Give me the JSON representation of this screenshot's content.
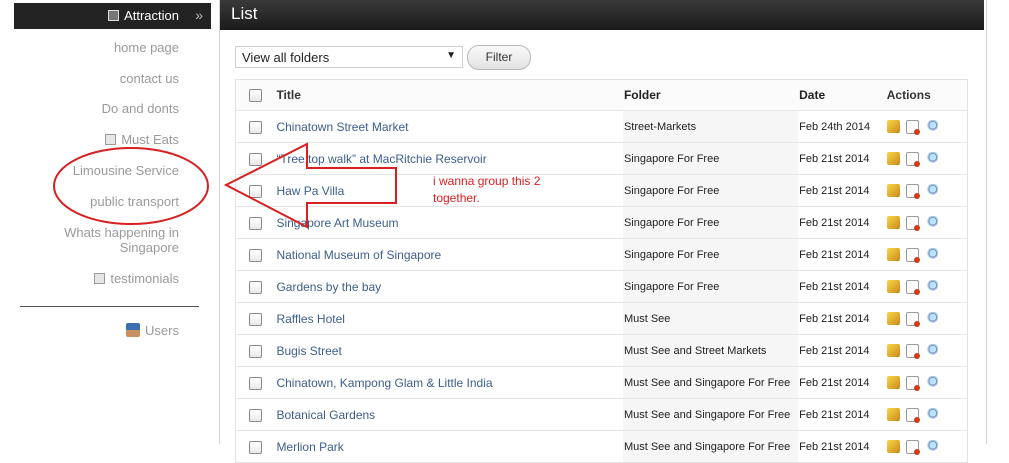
{
  "sidebar": {
    "active": {
      "label": "Attraction",
      "chevron": "»"
    },
    "items": [
      {
        "label": "home page",
        "has_icon": false
      },
      {
        "label": "contact us",
        "has_icon": false
      },
      {
        "label": "Do and donts",
        "has_icon": false
      },
      {
        "label": "Must Eats",
        "has_icon": true
      },
      {
        "label": "Limousine Service",
        "has_icon": false
      },
      {
        "label": "public transport",
        "has_icon": false
      },
      {
        "label": "Whats happening in Singapore",
        "has_icon": false
      },
      {
        "label": "testimonials",
        "has_icon": true
      }
    ],
    "users_label": "Users"
  },
  "main": {
    "title": "List",
    "folder_select": {
      "value": "View all folders",
      "arrow": "▼"
    },
    "filter_button": "Filter"
  },
  "table": {
    "headers": {
      "title": "Title",
      "folder": "Folder",
      "date": "Date",
      "actions": "Actions"
    },
    "rows": [
      {
        "title": "Chinatown Street Market",
        "folder": "Street-Markets",
        "date": "Feb 24th 2014"
      },
      {
        "title": "“Tree top walk” at MacRitchie Reservoir",
        "folder": "Singapore For Free",
        "date": "Feb 21st 2014"
      },
      {
        "title": "Haw Pa Villa",
        "folder": "Singapore For Free",
        "date": "Feb 21st 2014"
      },
      {
        "title": "Singapore Art Museum",
        "folder": "Singapore For Free",
        "date": "Feb 21st 2014"
      },
      {
        "title": "National Museum of Singapore",
        "folder": "Singapore For Free",
        "date": "Feb 21st 2014"
      },
      {
        "title": "Gardens by the bay",
        "folder": "Singapore For Free",
        "date": "Feb 21st 2014"
      },
      {
        "title": "Raffles Hotel",
        "folder": "Must See",
        "date": "Feb 21st 2014"
      },
      {
        "title": "Bugis Street",
        "folder": "Must See and Street Markets",
        "date": "Feb 21st 2014"
      },
      {
        "title": "Chinatown, Kampong Glam & Little India",
        "folder": "Must See and Singapore For Free",
        "date": "Feb 21st 2014"
      },
      {
        "title": "Botanical Gardens",
        "folder": "Must See and Singapore For Free",
        "date": "Feb 21st 2014"
      },
      {
        "title": "Merlion Park",
        "folder": "Must See and Singapore For Free",
        "date": "Feb 21st 2014"
      }
    ]
  },
  "annotation": {
    "text": "i wanna group this 2 together.",
    "color": "#d82020"
  }
}
